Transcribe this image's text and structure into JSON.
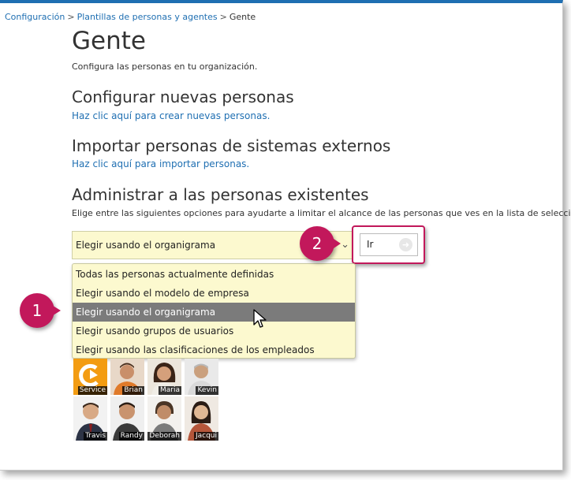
{
  "breadcrumb": {
    "items": [
      "Configuración",
      "Plantillas de personas y agentes",
      "Gente"
    ],
    "separator": ">"
  },
  "page": {
    "title": "Gente",
    "subtitle": "Configura las personas en tu organización."
  },
  "sections": {
    "new": {
      "heading": "Configurar nuevas personas",
      "link": "Haz clic aquí para crear nuevas personas."
    },
    "import": {
      "heading": "Importar personas de sistemas externos",
      "link": "Haz clic aquí para importar personas."
    },
    "manage": {
      "heading": "Administrar a las personas existentes",
      "description": "Elige entre las siguientes opciones para ayudarte a limitar el alcance de las personas que ves en la lista de selección."
    }
  },
  "select": {
    "value": "Elegir usando el organigrama",
    "options": [
      "Todas las personas actualmente definidas",
      "Elegir usando el modelo de empresa",
      "Elegir usando el organigrama",
      "Elegir usando grupos de usuarios",
      "Elegir usando las clasificaciones de los empleados"
    ],
    "highlighted_index": 2
  },
  "go_button": {
    "label": "Ir"
  },
  "callouts": {
    "one": "1",
    "two": "2"
  },
  "people": [
    {
      "name": "Service"
    },
    {
      "name": "Brian"
    },
    {
      "name": "Maria"
    },
    {
      "name": "Kevin"
    },
    {
      "name": "Travis"
    },
    {
      "name": "Randy"
    },
    {
      "name": "Deborah"
    },
    {
      "name": "Jacqui"
    }
  ],
  "colors": {
    "link": "#1f6fb2",
    "accent_callout": "#c2185b",
    "select_bg": "#fcf9cf",
    "selected_option_bg": "#7b7b7b",
    "service_logo": "#f39c12"
  }
}
